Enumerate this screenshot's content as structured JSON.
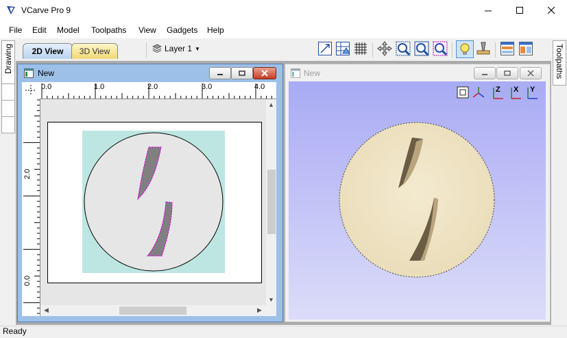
{
  "app": {
    "title": "VCarve Pro 9"
  },
  "menu": [
    "File",
    "Edit",
    "Model",
    "Toolpaths",
    "View",
    "Gadgets",
    "Help"
  ],
  "view_tabs": {
    "tab_2d": "2D View",
    "tab_3d": "3D View"
  },
  "layer": {
    "label": "Layer 1"
  },
  "side_tabs": {
    "left": "Drawing",
    "right": "Toolpaths"
  },
  "window_2d": {
    "title": "New"
  },
  "window_3d": {
    "title": "New"
  },
  "ruler_h": [
    "0.0",
    "1.0",
    "2.0",
    "3.0",
    "4.0"
  ],
  "ruler_v": [
    "2.0",
    "0.0"
  ],
  "status": {
    "text": "Ready"
  },
  "axes_3d": [
    "Z",
    "X",
    "Y"
  ],
  "colors": {
    "titlebar": "#ffffff",
    "window_active_frame": "#9cc0e8",
    "material": "#bde6e2",
    "disc": "#e6e6e6",
    "pocket": "#808080",
    "selection": "#d400d4",
    "view3d_top": "#a9abf4",
    "view3d_bottom": "#dcdcf9",
    "wood": "#efe3c4"
  }
}
